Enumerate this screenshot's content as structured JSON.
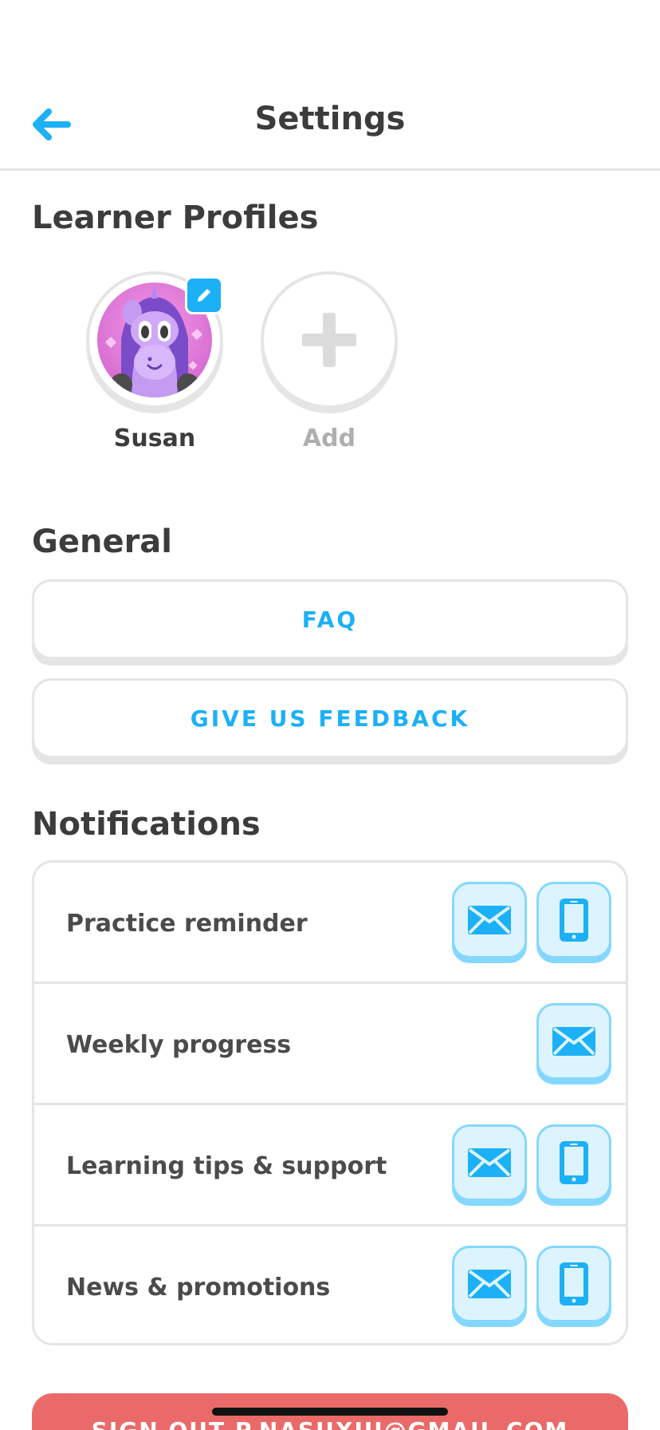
{
  "header": {
    "title": "Settings",
    "back_icon": "arrow-left-icon"
  },
  "profiles": {
    "title": "Learner Profiles",
    "items": [
      {
        "name": "Susan"
      }
    ],
    "add_label": "Add"
  },
  "general": {
    "title": "General",
    "buttons": [
      {
        "label": "FAQ"
      },
      {
        "label": "GIVE US FEEDBACK"
      }
    ]
  },
  "notifications": {
    "title": "Notifications",
    "rows": [
      {
        "label": "Practice reminder",
        "email": true,
        "push": true
      },
      {
        "label": "Weekly progress",
        "email": true,
        "push": false
      },
      {
        "label": "Learning tips & support",
        "email": true,
        "push": true
      },
      {
        "label": "News & promotions",
        "email": true,
        "push": true
      }
    ]
  },
  "signout": {
    "label": "SIGN OUT P.NASUXUI@GMAIL.COM"
  },
  "colors": {
    "accent": "#1cb0f6",
    "danger": "#ea6a6a",
    "border": "#e5e5e5",
    "toggle_bg": "#ddf4ff"
  }
}
